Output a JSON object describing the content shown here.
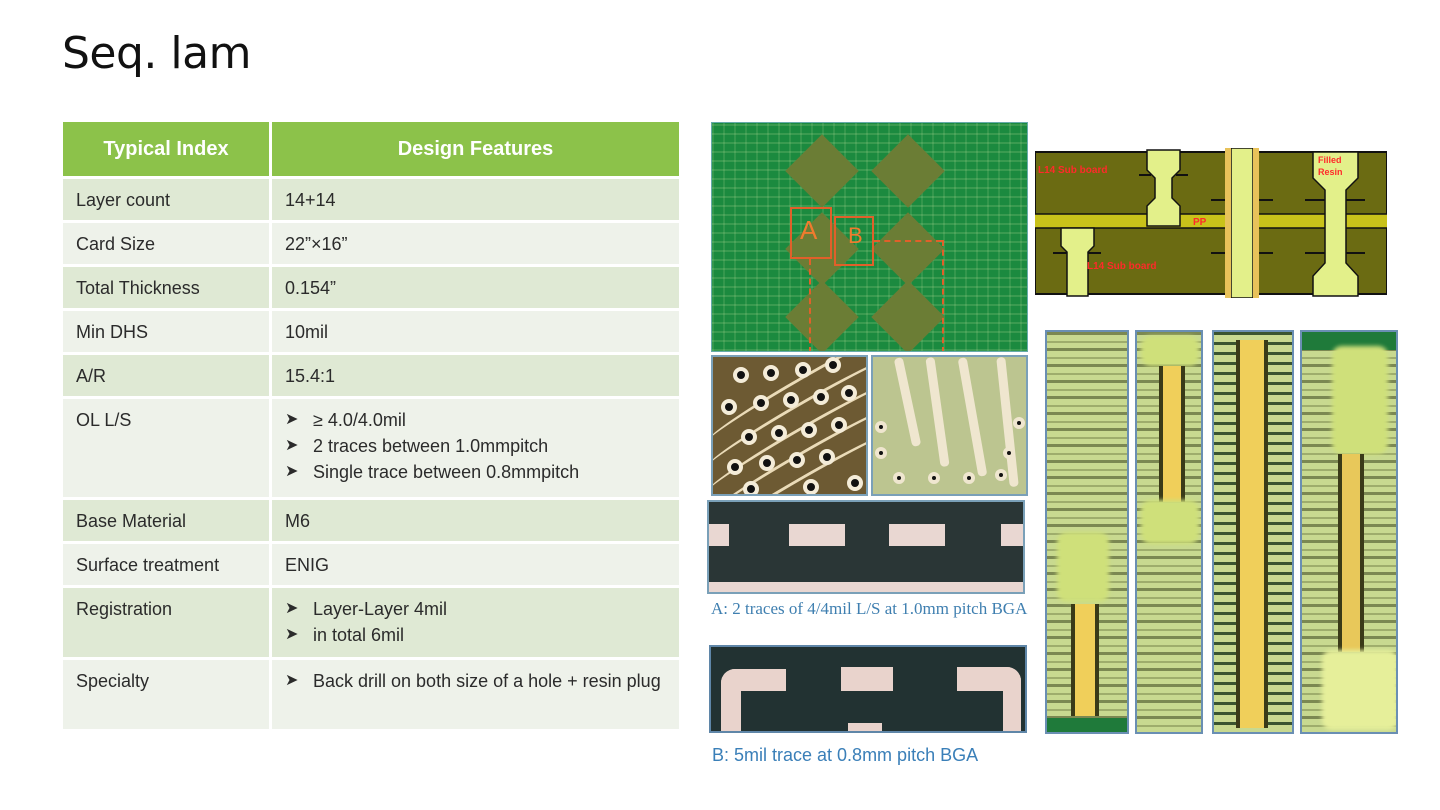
{
  "slide": {
    "title": "Seq. lam"
  },
  "table": {
    "headers": [
      "Typical Index",
      "Design Features"
    ],
    "rows": [
      {
        "label": "Layer count",
        "value": "14+14"
      },
      {
        "label": "Card Size",
        "value": "22”×16”"
      },
      {
        "label": "Total Thickness",
        "value": "0.154”"
      },
      {
        "label": "Min DHS",
        "value": "10mil"
      },
      {
        "label": "A/R",
        "value": "15.4:1"
      },
      {
        "label": "OL L/S",
        "bullets": [
          "≥ 4.0/4.0mil",
          "2 traces between 1.0mmpitch",
          "Single trace between 0.8mmpitch"
        ]
      },
      {
        "label": "Base Material",
        "value": "M6"
      },
      {
        "label": "Surface treatment",
        "value": "ENIG"
      },
      {
        "label": "Registration",
        "bullets": [
          "Layer-Layer 4mil",
          "in total 6mil"
        ]
      },
      {
        "label": "Specialty",
        "bullets": [
          "Back drill on both size of a hole + resin plug"
        ]
      }
    ],
    "bullet_icon": "arrowhead-bullet",
    "colors": {
      "header": "#8cc24a",
      "row_odd": "#dfe9d4",
      "row_even": "#eef2ea"
    }
  },
  "images": {
    "pcb_overview": {
      "region_labels": [
        "A",
        "B"
      ]
    },
    "caption_a": "A: 2 traces of 4/4mil L/S at 1.0mm pitch BGA",
    "caption_b": "B: 5mil trace at 0.8mm pitch BGA",
    "stackup_diagram": {
      "labels": {
        "top_sub": "L14 Sub board",
        "bottom_sub": "L14 Sub board",
        "prepreg": "PP",
        "filled": "Filled Resin"
      }
    },
    "microsections_count": 4
  },
  "colors": {
    "caption": "#3f7fb0",
    "accent": "#8cc24a"
  }
}
